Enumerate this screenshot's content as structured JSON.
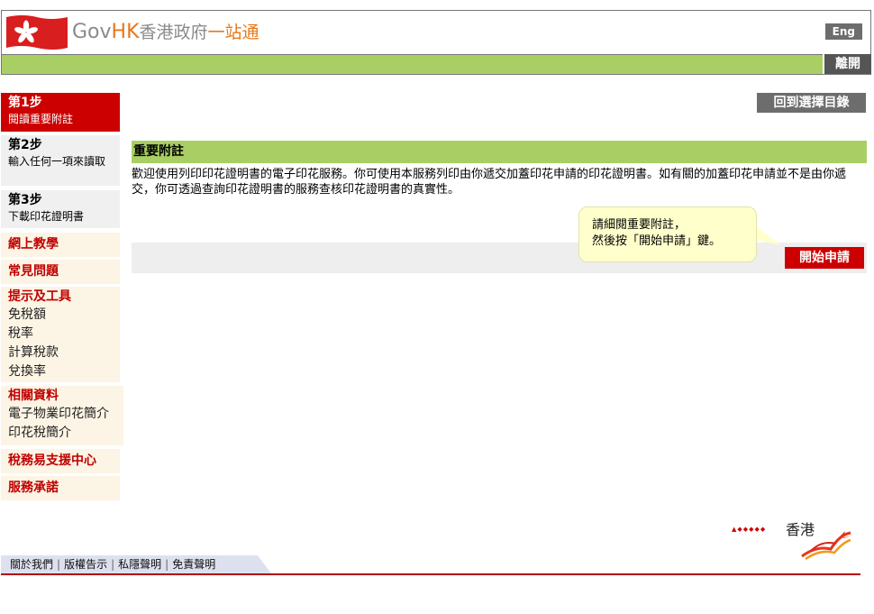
{
  "header": {
    "brand_gov": "Gov",
    "brand_hk": "HK",
    "brand_cn": "香港政府",
    "brand_cn2": "一站通",
    "lang_button": "Eng",
    "leave_button": "離開",
    "colors": {
      "accent_green": "#a9cf64",
      "accent_red": "#cc0000",
      "gray": "#6d6d6d"
    }
  },
  "steps": [
    {
      "title": "第1步",
      "desc": "閱讀重要附註"
    },
    {
      "title": "第2步",
      "desc": "輸入任何一項來讀取"
    },
    {
      "title": "第3步",
      "desc": "下載印花證明書"
    }
  ],
  "sidebar": {
    "online_tutorial": "網上教學",
    "faq": "常見問題",
    "tips_tools": {
      "heading": "提示及工具",
      "items": [
        "免稅額",
        "稅率",
        "計算稅款",
        "兌換率"
      ]
    },
    "related": {
      "heading": "相關資料",
      "items": [
        "電子物業印花簡介",
        "印花稅簡介"
      ]
    },
    "support": "稅務易支援中心",
    "pledge": "服務承諾"
  },
  "main": {
    "back_button": "回到選擇目錄",
    "section_heading": "重要附註",
    "body": "歡迎使用列印印花證明書的電子印花服務。你可使用本服務列印由你遞交加蓋印花申請的印花證明書。如有關的加蓋印花申請並不是由你遞交，你可透過查詢印花證明書的服務查核印花證明書的真實性。",
    "tooltip_line1": "請細閱重要附註，",
    "tooltip_line2": "然後按「開始申請」鍵。",
    "start_button": "開始申請"
  },
  "footer": {
    "links": [
      "關於我們",
      "版權告示",
      "私隱聲明",
      "免責聲明"
    ],
    "separator": "|",
    "logo_text": "香港"
  }
}
